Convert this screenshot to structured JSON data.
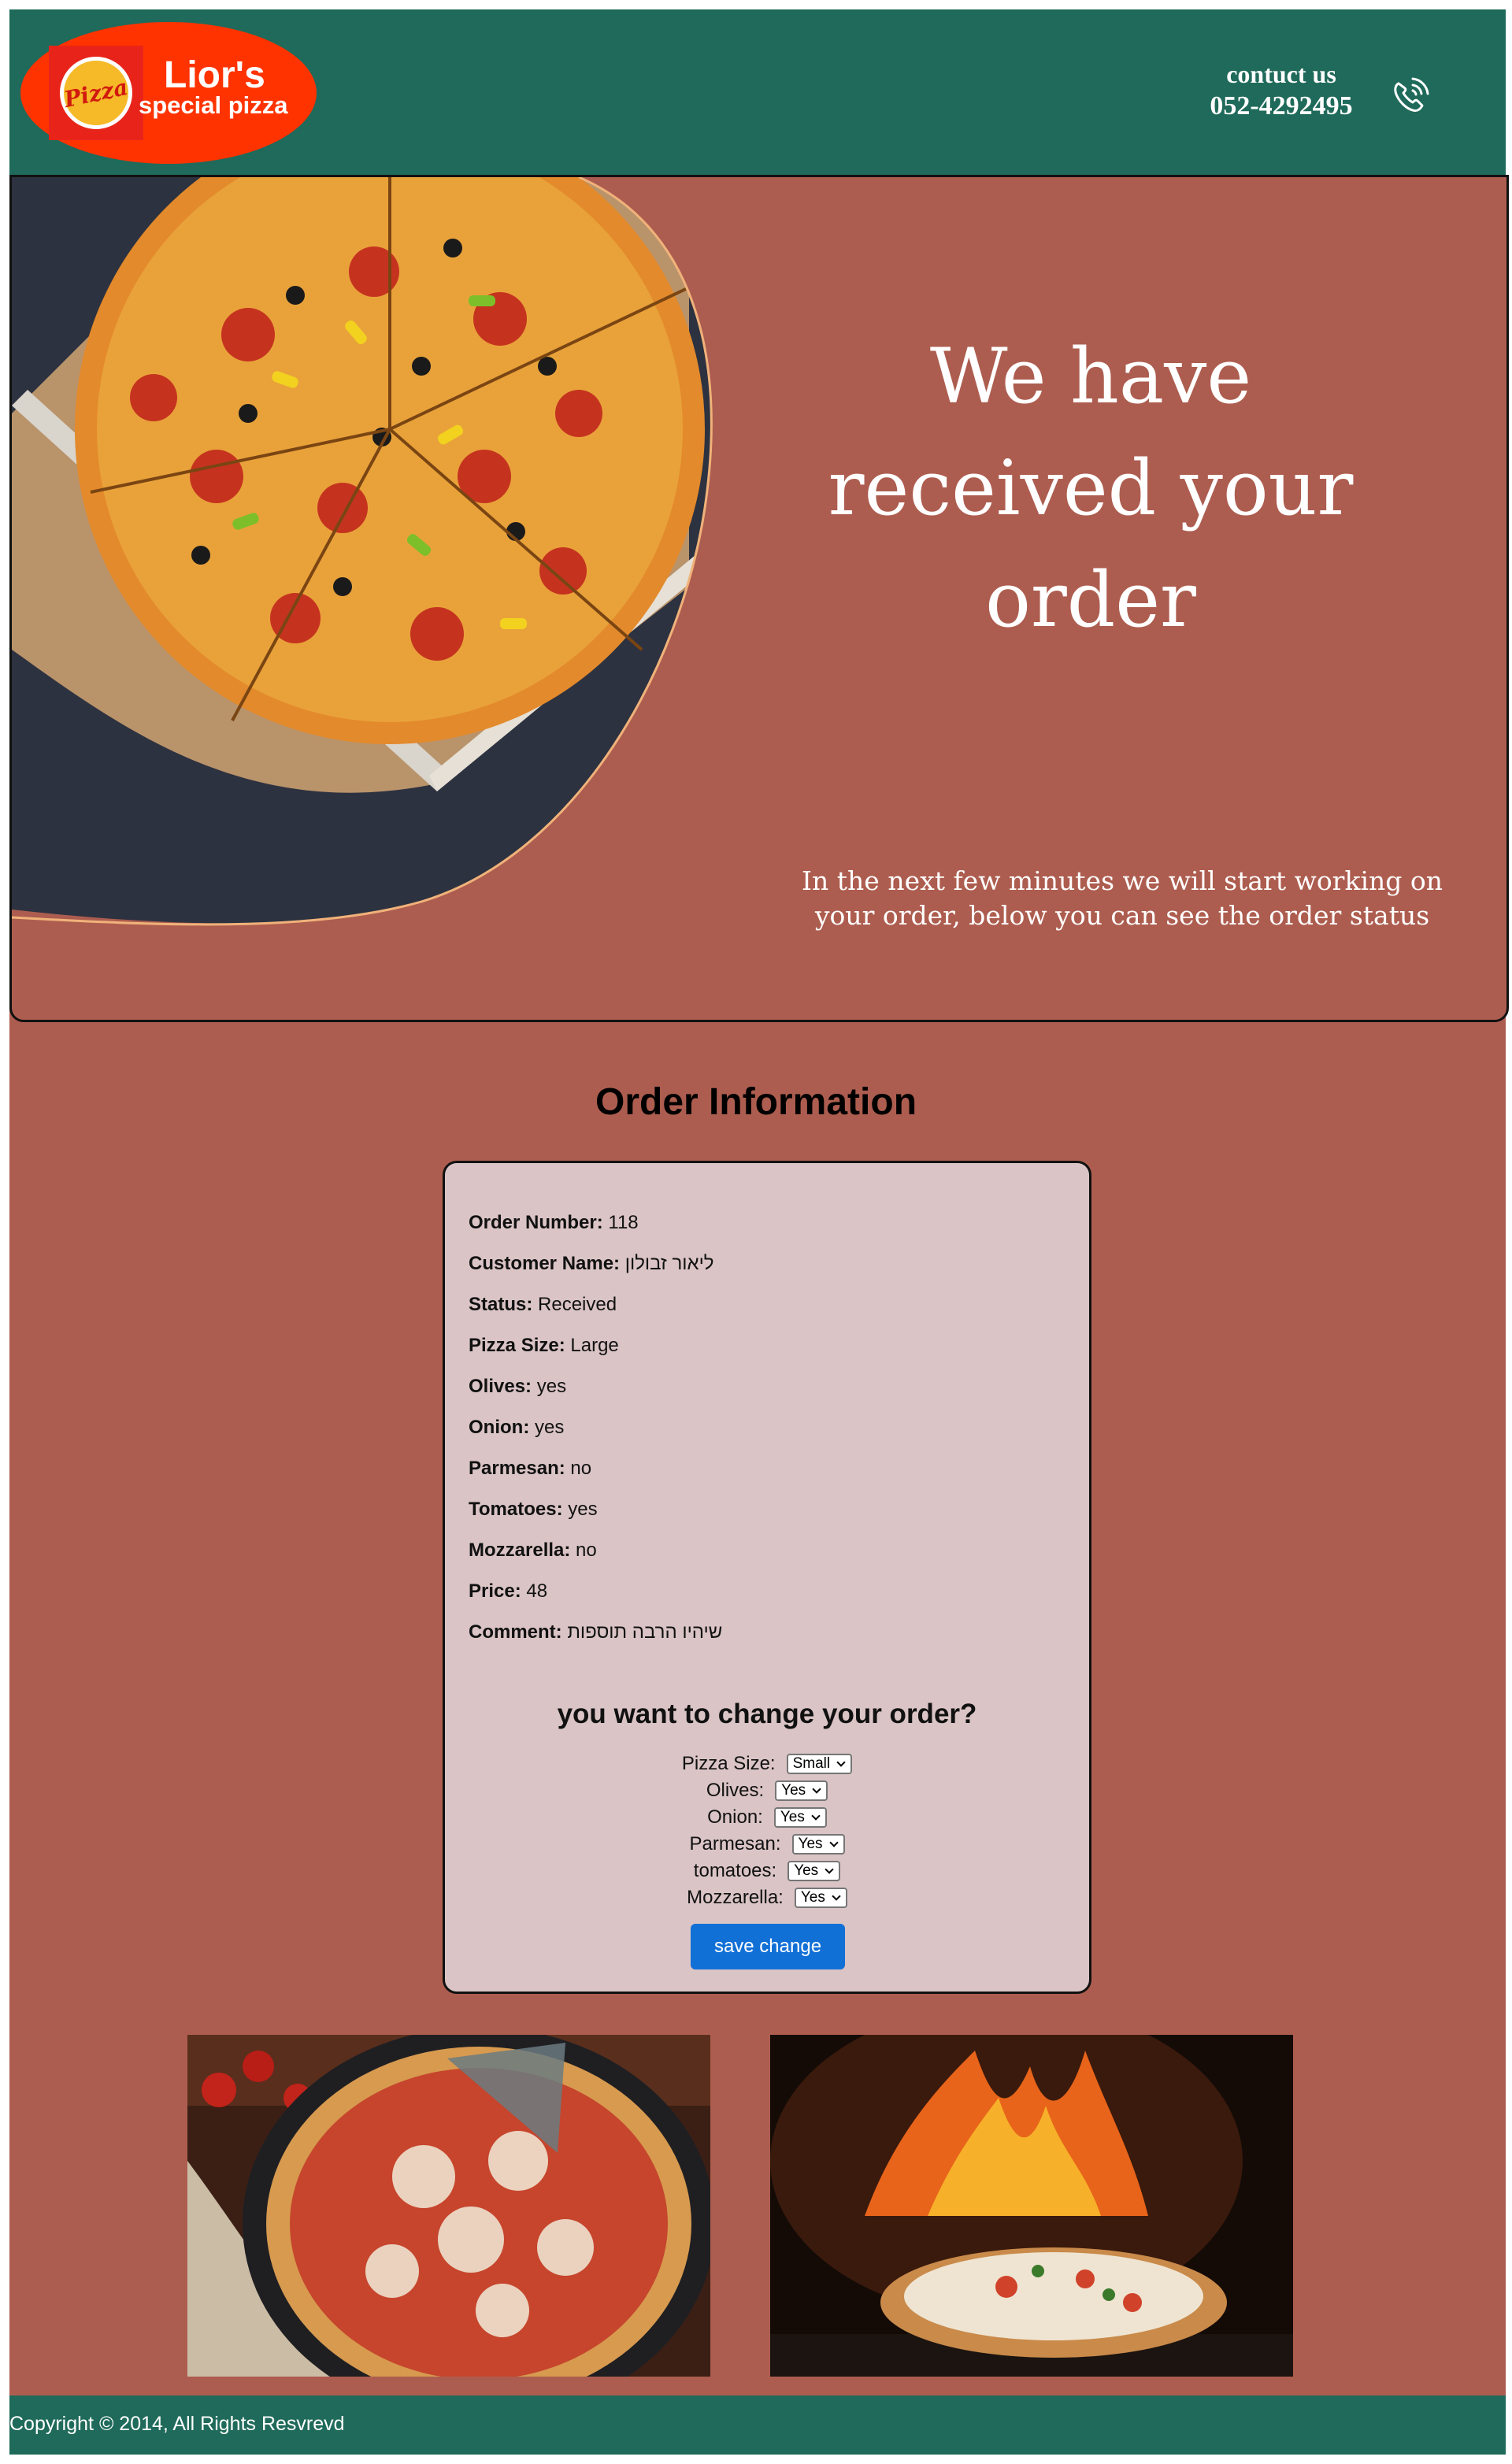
{
  "header": {
    "logo_badge": "Pizza",
    "logo_title": "Lior's",
    "logo_subtitle": "special pizza",
    "contact_label": "contuct us",
    "contact_phone": "052-4292495"
  },
  "hero": {
    "title": "We have received your order",
    "subtitle": "In the next few minutes we will start working on your order, below you can see the order status"
  },
  "order": {
    "heading": "Order Information",
    "fields": [
      {
        "label": "Order Number:",
        "value": "118"
      },
      {
        "label": "Customer Name:",
        "value": "ליאור זבולון"
      },
      {
        "label": "Status:",
        "value": "Received"
      },
      {
        "label": "Pizza Size:",
        "value": "Large"
      },
      {
        "label": "Olives:",
        "value": "yes"
      },
      {
        "label": "Onion:",
        "value": "yes"
      },
      {
        "label": "Parmesan:",
        "value": "no"
      },
      {
        "label": "Tomatoes:",
        "value": "yes"
      },
      {
        "label": "Mozzarella:",
        "value": "no"
      },
      {
        "label": "Price:",
        "value": "48"
      },
      {
        "label": "Comment:",
        "value": "שיהיו הרבה תוספות"
      }
    ]
  },
  "change_form": {
    "heading": "you want to change your order?",
    "rows": [
      {
        "label": "Pizza Size:",
        "selected": "Small"
      },
      {
        "label": "Olives:",
        "selected": "Yes"
      },
      {
        "label": "Onion:",
        "selected": "Yes"
      },
      {
        "label": "Parmesan:",
        "selected": "Yes"
      },
      {
        "label": "tomatoes:",
        "selected": "Yes"
      },
      {
        "label": "Mozzarella:",
        "selected": "Yes"
      }
    ],
    "save_label": "save change"
  },
  "footer": {
    "copyright": "Copyright © 2014, All Rights Resvrevd"
  },
  "colors": {
    "header_bg": "#1f6a5a",
    "page_bg": "#ad5d4f",
    "card_bg": "#dac4c5",
    "button_bg": "#1170d6",
    "logo_oval": "#ff3300"
  }
}
